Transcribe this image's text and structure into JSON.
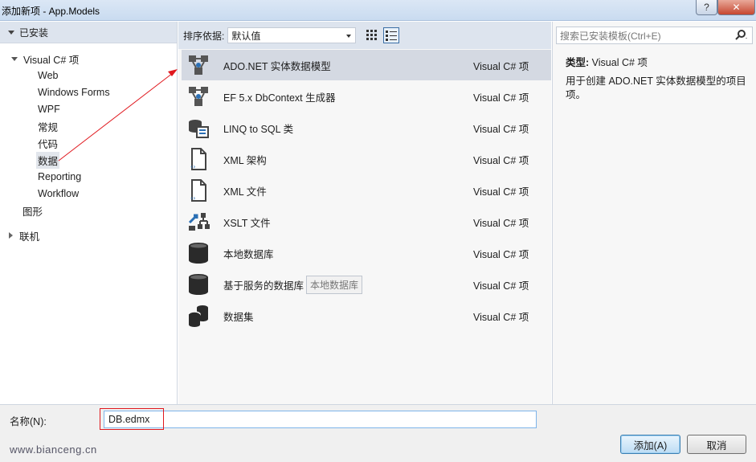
{
  "window": {
    "title": "添加新项 - App.Models",
    "help": "?",
    "close": "✕"
  },
  "left": {
    "header": "已安装",
    "tree": [
      {
        "label": "Visual C# 项",
        "level": 0,
        "expanded": true
      },
      {
        "label": "Web",
        "level": 1
      },
      {
        "label": "Windows Forms",
        "level": 1
      },
      {
        "label": "WPF",
        "level": 1
      },
      {
        "label": "常规",
        "level": 1
      },
      {
        "label": "代码",
        "level": 1
      },
      {
        "label": "数据",
        "level": 1,
        "selected": true
      },
      {
        "label": "Reporting",
        "level": 1
      },
      {
        "label": "Workflow",
        "level": 1
      },
      {
        "label": "图形",
        "level": 0
      },
      {
        "label": "联机",
        "level": 0,
        "collapsed": true
      }
    ]
  },
  "toolbar": {
    "sort_label": "排序依据:",
    "sort_value": "默认值"
  },
  "items": [
    {
      "name": "ADO.NET 实体数据模型",
      "lang": "Visual C# 项",
      "icon": "ado-net-entity-icon",
      "selected": true
    },
    {
      "name": "EF 5.x DbContext 生成器",
      "lang": "Visual C# 项",
      "icon": "dbcontext-generator-icon"
    },
    {
      "name": "LINQ to SQL 类",
      "lang": "Visual C# 项",
      "icon": "linq-to-sql-icon"
    },
    {
      "name": "XML 架构",
      "lang": "Visual C# 项",
      "icon": "xml-schema-icon"
    },
    {
      "name": "XML 文件",
      "lang": "Visual C# 项",
      "icon": "xml-file-icon"
    },
    {
      "name": "XSLT 文件",
      "lang": "Visual C# 项",
      "icon": "xslt-file-icon"
    },
    {
      "name": "本地数据库",
      "lang": "Visual C# 项",
      "icon": "local-database-icon"
    },
    {
      "name": "基于服务的数据库",
      "lang": "Visual C# 项",
      "icon": "service-database-icon",
      "chip": "本地数据库"
    },
    {
      "name": "数据集",
      "lang": "Visual C# 项",
      "icon": "dataset-icon"
    }
  ],
  "search": {
    "placeholder": "搜索已安装模板(Ctrl+E)"
  },
  "detail": {
    "type_label": "类型:",
    "type_value": "Visual C# 项",
    "description": "用于创建 ADO.NET 实体数据模型的项目项。"
  },
  "bottom": {
    "name_label": "名称(N):",
    "name_value": "DB.edmx",
    "add_button": "添加(A)",
    "cancel_button": "取消",
    "watermark": "www.bianceng.cn"
  },
  "colors": {
    "annotation_red": "#e0181e",
    "selection": "#d4d9e2",
    "panel_header": "#dde4ee"
  }
}
